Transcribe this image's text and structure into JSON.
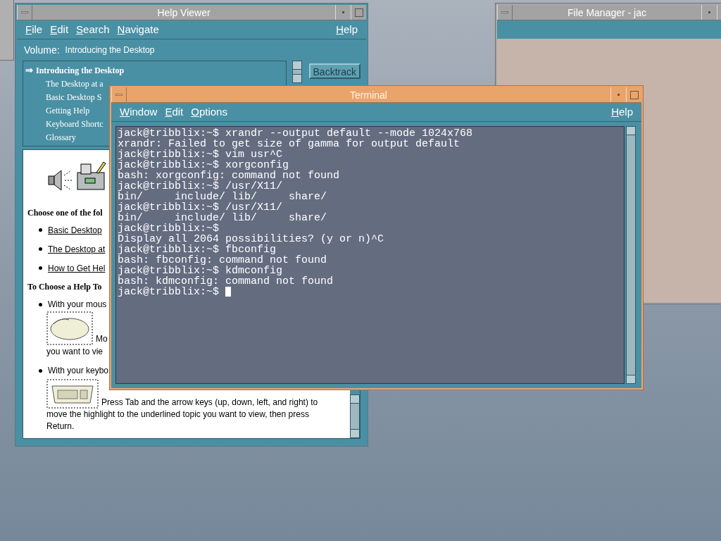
{
  "help_viewer": {
    "title": "Help Viewer",
    "menu_left": [
      "File",
      "Edit",
      "Search",
      "Navigate"
    ],
    "menu_right": "Help",
    "volume_label": "Volume:",
    "volume_value": "Introducing the Desktop",
    "topics": [
      {
        "label": "Introducing the Desktop",
        "selected": true,
        "marker": "⇒"
      },
      {
        "label": "The Desktop at a",
        "selected": false
      },
      {
        "label": "Basic Desktop S",
        "selected": false
      },
      {
        "label": "Getting Help",
        "selected": false
      },
      {
        "label": "Keyboard Shortc",
        "selected": false
      },
      {
        "label": "Glossary",
        "selected": false
      }
    ],
    "backtrack": "Backtrack",
    "content": {
      "heading_1": "Choose one of the fol",
      "links": [
        "Basic Desktop",
        "The Desktop at",
        "How to Get Hel"
      ],
      "heading_2": "To Choose a Help To",
      "mouse_item": {
        "line_1": "With your mous",
        "after_image": "Mo",
        "line_2": "you want to vie"
      },
      "keyboard_item": {
        "line_1": "With your keybo",
        "paragraph": "Press Tab and the arrow keys (up, down, left, and right) to move the highlight to the underlined topic you want to view, then press Return."
      }
    }
  },
  "file_manager": {
    "title": "File Manager - jac"
  },
  "terminal": {
    "title": "Terminal",
    "menu_left": [
      "Window",
      "Edit",
      "Options"
    ],
    "menu_right": "Help",
    "lines": [
      "jack@tribblix:~$ xrandr --output default --mode 1024x768",
      "xrandr: Failed to get size of gamma for output default",
      "jack@tribblix:~$ vim usr^C",
      "jack@tribblix:~$ xorgconfig",
      "bash: xorgconfig: command not found",
      "jack@tribblix:~$ /usr/X11/",
      "bin/     include/ lib/     share/",
      "jack@tribblix:~$ /usr/X11/",
      "bin/     include/ lib/     share/",
      "jack@tribblix:~$",
      "Display all 2064 possibilities? (y or n)^C",
      "jack@tribblix:~$ fbconfig",
      "bash: fbconfig: command not found",
      "jack@tribblix:~$ kdmconfig",
      "bash: kdmconfig: command not found",
      "jack@tribblix:~$"
    ]
  }
}
